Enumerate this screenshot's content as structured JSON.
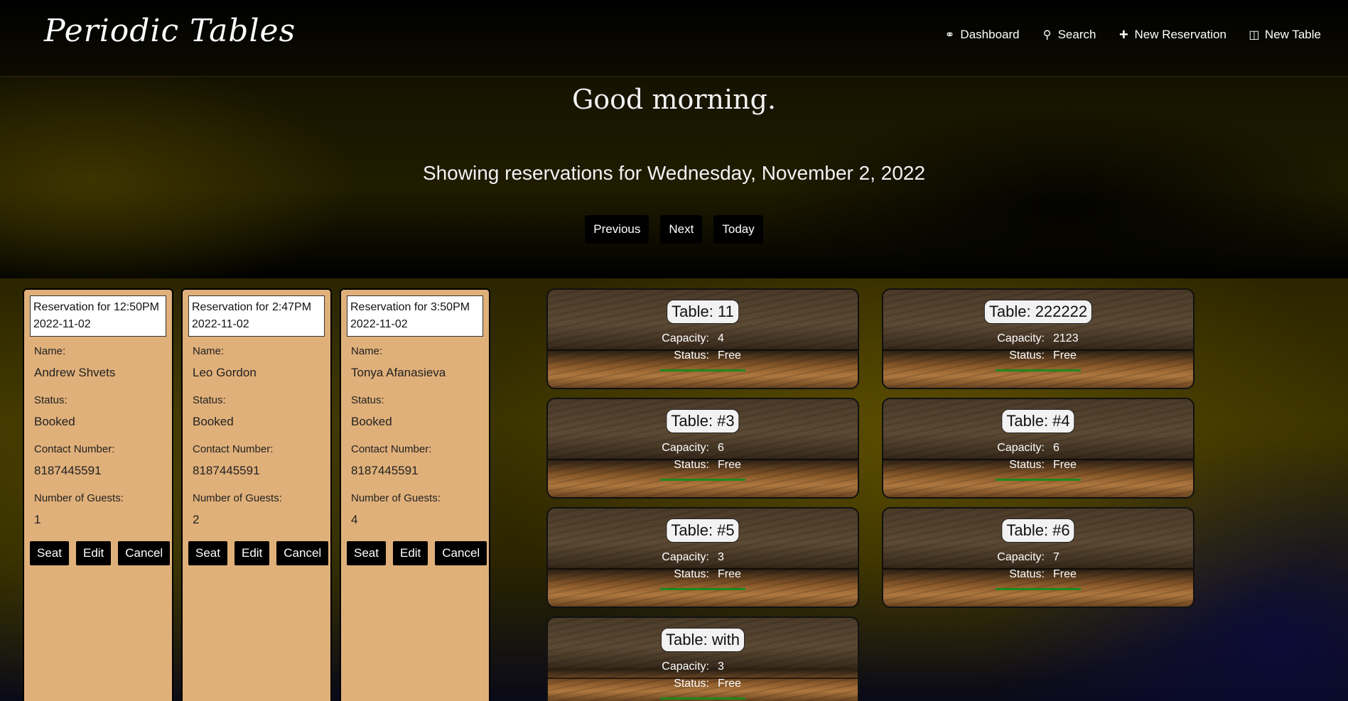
{
  "nav": {
    "brand": "Periodic Tables",
    "links": [
      {
        "label": "Dashboard",
        "icon": "dashboard-icon"
      },
      {
        "label": "Search",
        "icon": "search-icon"
      },
      {
        "label": "New Reservation",
        "icon": "plus-icon"
      },
      {
        "label": "New Table",
        "icon": "new-table-icon"
      }
    ]
  },
  "hero": {
    "greeting": "Good morning.",
    "date_line": "Showing reservations for Wednesday, November 2, 2022",
    "buttons": {
      "previous": "Previous",
      "next": "Next",
      "today": "Today"
    }
  },
  "labels": {
    "name": "Name:",
    "status": "Status:",
    "contact": "Contact Number:",
    "guests": "Number of Guests:",
    "seat": "Seat",
    "edit": "Edit",
    "cancel": "Cancel",
    "capacity": "Capacity:",
    "table_status": "Status:"
  },
  "reservations": [
    {
      "title": "Reservation for 12:50PM",
      "date": "2022-11-02",
      "name": "Andrew Shvets",
      "status": "Booked",
      "contact": "8187445591",
      "guests": "1"
    },
    {
      "title": "Reservation for 2:47PM",
      "date": "2022-11-02",
      "name": "Leo Gordon",
      "status": "Booked",
      "contact": "8187445591",
      "guests": "2"
    },
    {
      "title": "Reservation for 3:50PM",
      "date": "2022-11-02",
      "name": "Tonya Afanasieva",
      "status": "Booked",
      "contact": "8187445591",
      "guests": "4"
    }
  ],
  "tables": [
    {
      "title": "Table: 11",
      "capacity": "4",
      "status": "Free"
    },
    {
      "title": "Table: 222222",
      "capacity": "2123",
      "status": "Free"
    },
    {
      "title": "Table: #3",
      "capacity": "6",
      "status": "Free"
    },
    {
      "title": "Table: #4",
      "capacity": "6",
      "status": "Free"
    },
    {
      "title": "Table: #5",
      "capacity": "3",
      "status": "Free"
    },
    {
      "title": "Table: #6",
      "capacity": "7",
      "status": "Free"
    },
    {
      "title": "Table: with",
      "capacity": "3",
      "status": "Free"
    }
  ],
  "colors": {
    "reservation_card": "#e0b07a",
    "status_free": "#1c8a1c"
  }
}
